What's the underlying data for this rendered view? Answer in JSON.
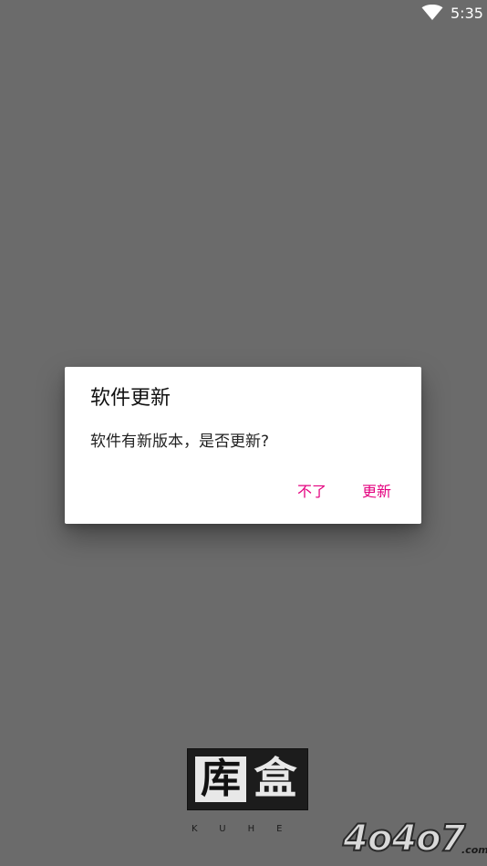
{
  "status_bar": {
    "time": "5:35",
    "icon": "wifi-icon"
  },
  "dialog": {
    "title": "软件更新",
    "message": "软件有新版本，是否更新?",
    "cancel_label": "不了",
    "confirm_label": "更新",
    "accent_color": "#e4007f"
  },
  "logo": {
    "char_left": "库",
    "char_right": "盒",
    "subtitle": "KUHE"
  },
  "watermark": {
    "text": "4o4o7",
    "suffix": ".com"
  }
}
